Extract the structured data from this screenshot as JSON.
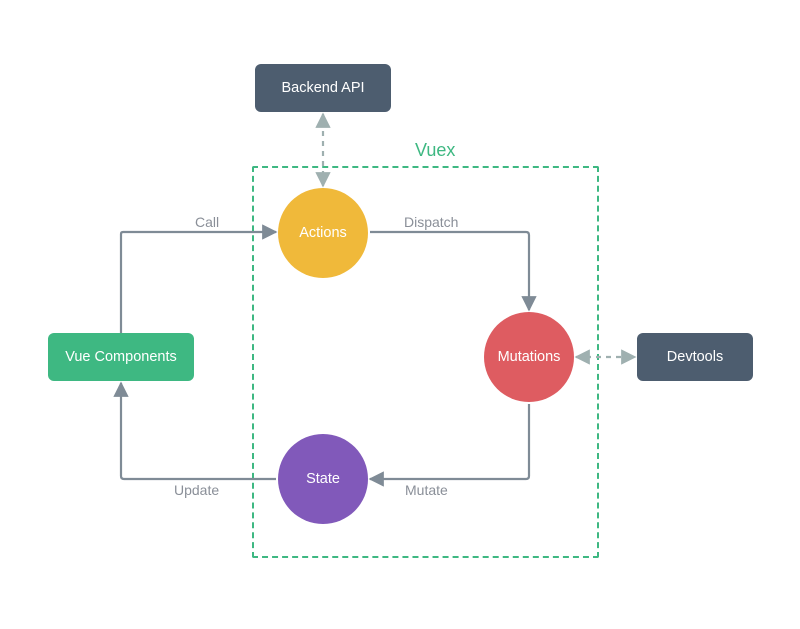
{
  "title": "Vuex",
  "boxes": {
    "backend_api": "Backend API",
    "vue_components": "Vue Components",
    "devtools": "Devtools"
  },
  "circles": {
    "actions": "Actions",
    "mutations": "Mutations",
    "state": "State"
  },
  "edges": {
    "call": "Call",
    "dispatch": "Dispatch",
    "mutate": "Mutate",
    "update": "Update"
  },
  "colors": {
    "vuex_border": "#3eb882",
    "slate": "#4d5d6f",
    "yellow": "#f0b93a",
    "red": "#de5c61",
    "purple": "#8159ba",
    "arrow": "#7f8b96",
    "label": "#8a8f98"
  }
}
